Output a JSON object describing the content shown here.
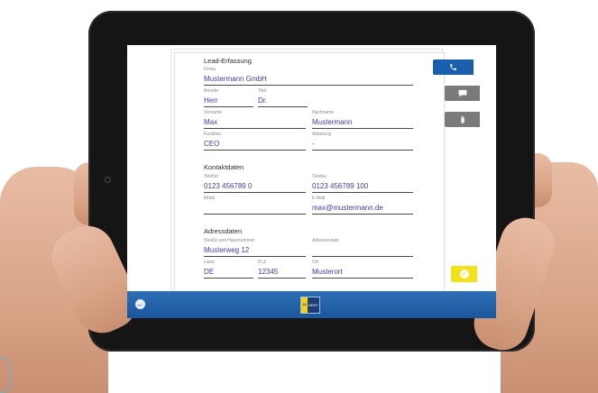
{
  "app": {
    "logo_badge": "JA",
    "logo_text": "DENT"
  },
  "form": {
    "title": "Lead-Erfassung",
    "firma_label": "Firma",
    "firma_value": "Mustermann GmbH",
    "anrede_label": "Anrede",
    "anrede_value": "Herr",
    "titel_label": "Titel",
    "titel_value": "Dr.",
    "vorname_label": "Vorname",
    "vorname_value": "Max",
    "nachname_label": "Nachname",
    "nachname_value": "Mustermann",
    "funktion_label": "Funktion",
    "funktion_value": "CEO",
    "abteilung_label": "Abteilung",
    "abteilung_value": "-"
  },
  "kontakt": {
    "title": "Kontaktdaten",
    "telefon_label": "Telefon",
    "telefon_value": "0123 456789 0",
    "telefax_label": "Telefax",
    "telefax_value": "0123 456789 100",
    "mobil_label": "Mobil",
    "mobil_value": "",
    "email_label": "E-Mail",
    "email_value": "max@mustermann.de"
  },
  "adresse": {
    "title": "Adressdaten",
    "strasse_label": "Straße und Hausnummer",
    "strasse_value": "Musterweg 12",
    "zusatz_label": "Adresszusatz",
    "zusatz_value": "",
    "land_label": "Land",
    "land_value": "DE",
    "plz_label": "PLZ",
    "plz_value": "12345",
    "ort_label": "Ort",
    "ort_value": "Musterort"
  },
  "colors": {
    "primary_blue": "#1a5fae",
    "button_gray": "#7a7a7a",
    "confirm_yellow": "#f3e11c",
    "input_text": "#3c3fa5"
  },
  "icons": {
    "phone": "phone-icon",
    "chat": "chat-bubble-icon",
    "attach": "paperclip-icon",
    "confirm": "checkmark-icon",
    "back": "back-arrow-icon"
  }
}
